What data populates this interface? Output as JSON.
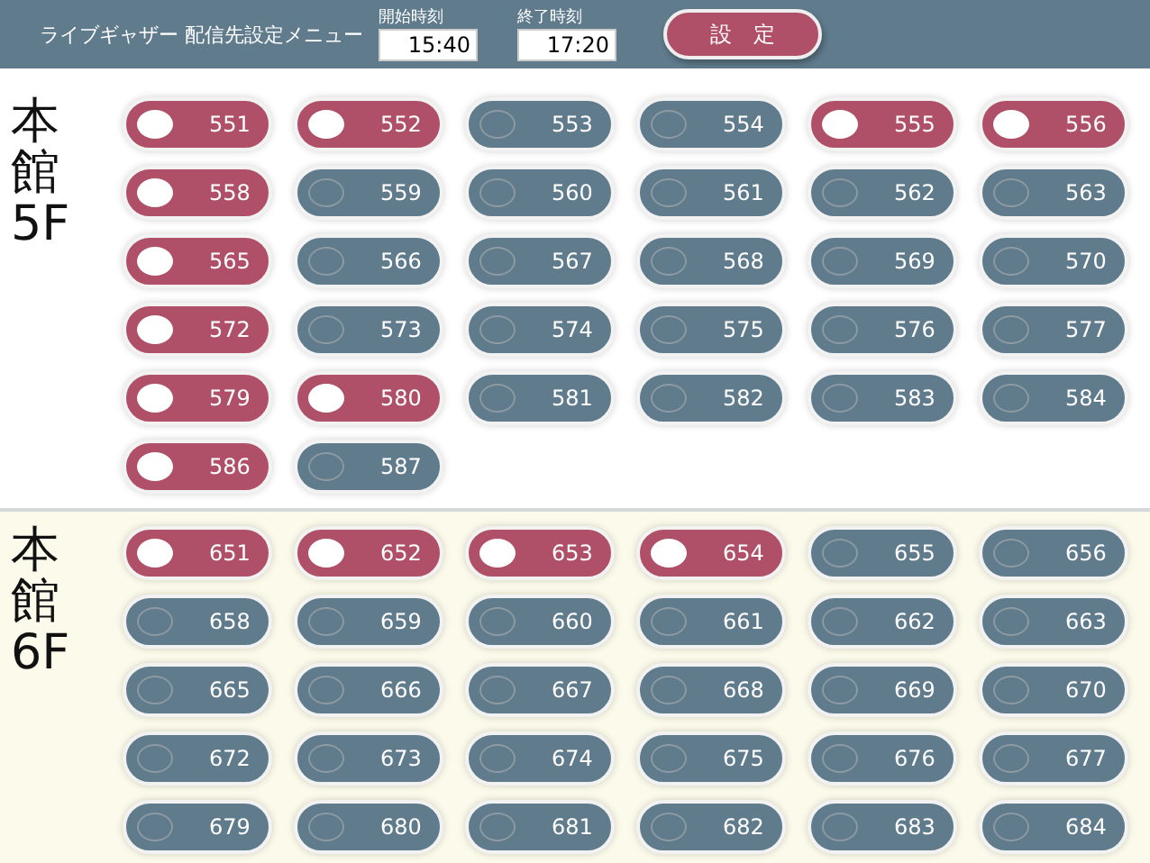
{
  "header": {
    "title": "ライブギャザー 配信先設定メニュー",
    "start": {
      "label": "開始時刻",
      "value": "15:40"
    },
    "end": {
      "label": "終了時刻",
      "value": "17:20"
    },
    "button": "設　定"
  },
  "sections": [
    {
      "building": "本館",
      "floor": "5F",
      "tinted": false,
      "rooms": [
        {
          "label": "551",
          "selected": true
        },
        {
          "label": "552",
          "selected": true
        },
        {
          "label": "553",
          "selected": false
        },
        {
          "label": "554",
          "selected": false
        },
        {
          "label": "555",
          "selected": true
        },
        {
          "label": "556",
          "selected": true
        },
        {
          "label": "558",
          "selected": true
        },
        {
          "label": "559",
          "selected": false
        },
        {
          "label": "560",
          "selected": false
        },
        {
          "label": "561",
          "selected": false
        },
        {
          "label": "562",
          "selected": false
        },
        {
          "label": "563",
          "selected": false
        },
        {
          "label": "565",
          "selected": true
        },
        {
          "label": "566",
          "selected": false
        },
        {
          "label": "567",
          "selected": false
        },
        {
          "label": "568",
          "selected": false
        },
        {
          "label": "569",
          "selected": false
        },
        {
          "label": "570",
          "selected": false
        },
        {
          "label": "572",
          "selected": true
        },
        {
          "label": "573",
          "selected": false
        },
        {
          "label": "574",
          "selected": false
        },
        {
          "label": "575",
          "selected": false
        },
        {
          "label": "576",
          "selected": false
        },
        {
          "label": "577",
          "selected": false
        },
        {
          "label": "579",
          "selected": true
        },
        {
          "label": "580",
          "selected": true
        },
        {
          "label": "581",
          "selected": false
        },
        {
          "label": "582",
          "selected": false
        },
        {
          "label": "583",
          "selected": false
        },
        {
          "label": "584",
          "selected": false
        },
        {
          "label": "586",
          "selected": true
        },
        {
          "label": "587",
          "selected": false
        }
      ]
    },
    {
      "building": "本館",
      "floor": "6F",
      "tinted": true,
      "rooms": [
        {
          "label": "651",
          "selected": true
        },
        {
          "label": "652",
          "selected": true
        },
        {
          "label": "653",
          "selected": true
        },
        {
          "label": "654",
          "selected": true
        },
        {
          "label": "655",
          "selected": false
        },
        {
          "label": "656",
          "selected": false
        },
        {
          "label": "658",
          "selected": false
        },
        {
          "label": "659",
          "selected": false
        },
        {
          "label": "660",
          "selected": false
        },
        {
          "label": "661",
          "selected": false
        },
        {
          "label": "662",
          "selected": false
        },
        {
          "label": "663",
          "selected": false
        },
        {
          "label": "665",
          "selected": false
        },
        {
          "label": "666",
          "selected": false
        },
        {
          "label": "667",
          "selected": false
        },
        {
          "label": "668",
          "selected": false
        },
        {
          "label": "669",
          "selected": false
        },
        {
          "label": "670",
          "selected": false
        },
        {
          "label": "672",
          "selected": false
        },
        {
          "label": "673",
          "selected": false
        },
        {
          "label": "674",
          "selected": false
        },
        {
          "label": "675",
          "selected": false
        },
        {
          "label": "676",
          "selected": false
        },
        {
          "label": "677",
          "selected": false
        },
        {
          "label": "679",
          "selected": false
        },
        {
          "label": "680",
          "selected": false
        },
        {
          "label": "681",
          "selected": false
        },
        {
          "label": "682",
          "selected": false
        },
        {
          "label": "683",
          "selected": false
        },
        {
          "label": "684",
          "selected": false
        }
      ]
    }
  ]
}
